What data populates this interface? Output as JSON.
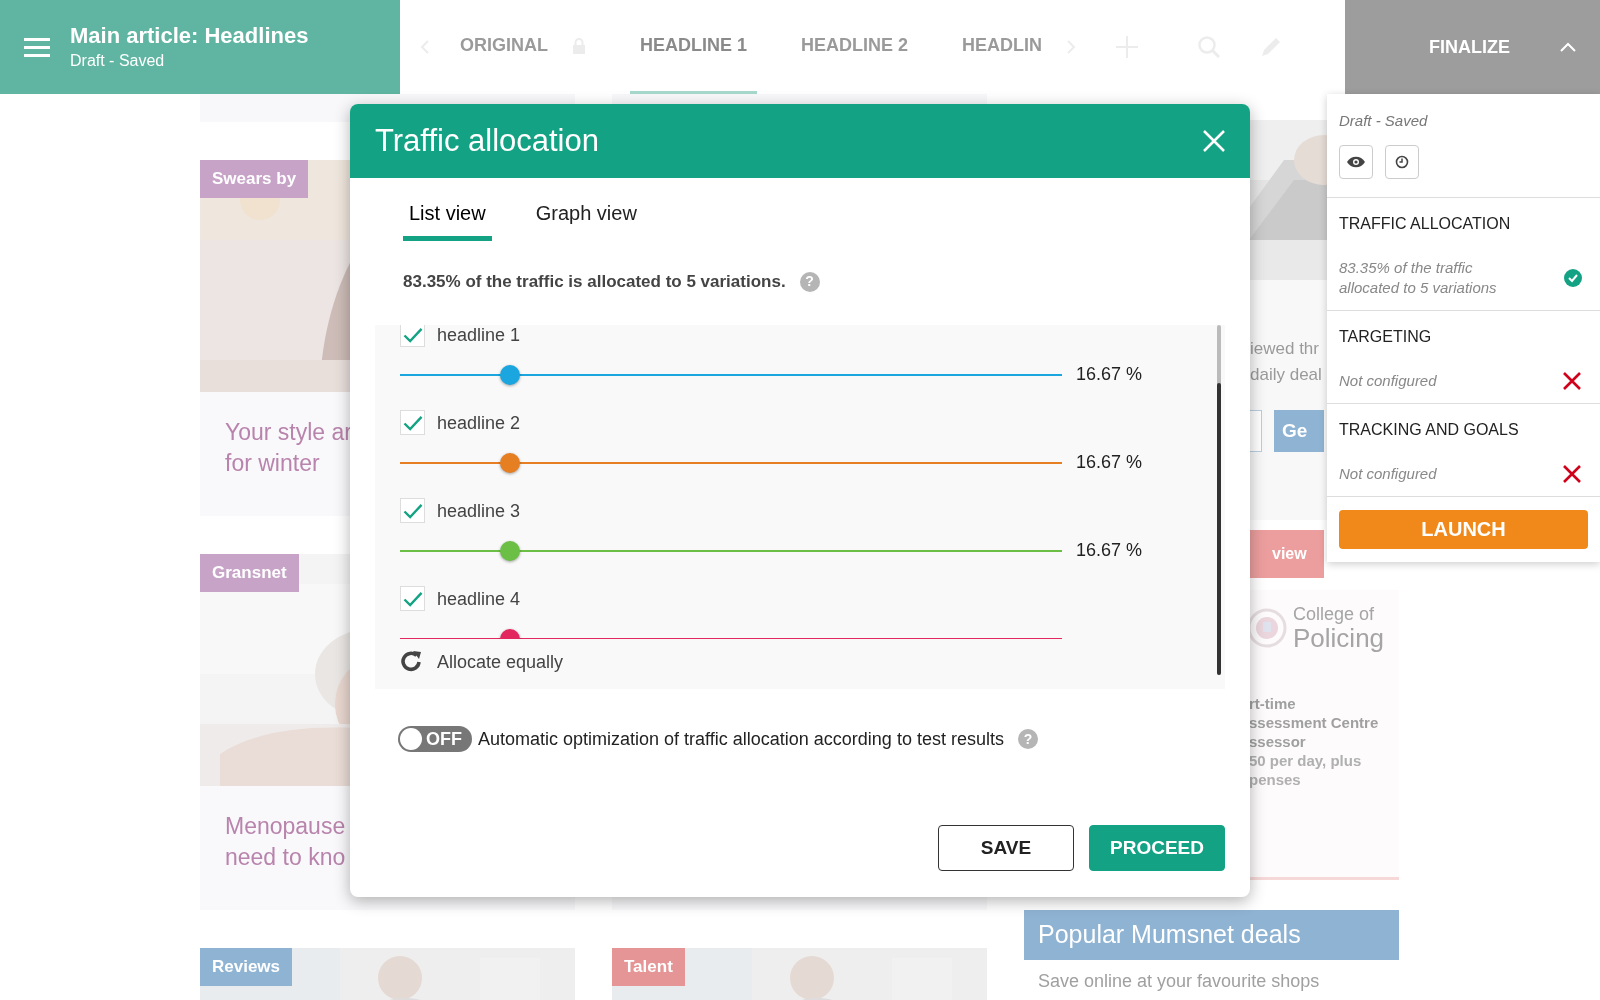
{
  "top_bar": {
    "title": "Main article: Headlines",
    "subtitle": "Draft - Saved",
    "tabs": [
      {
        "label": "ORIGINAL",
        "locked": true,
        "selected": false
      },
      {
        "label": "HEADLINE 1",
        "locked": false,
        "selected": true
      },
      {
        "label": "HEADLINE 2",
        "locked": false,
        "selected": false
      },
      {
        "label": "HEADLIN",
        "locked": false,
        "selected": false
      }
    ],
    "finalize": "FINALIZE"
  },
  "background": {
    "left_column": [
      {
        "tag": "Swears by",
        "color": "#c7a3c7",
        "lines": [
          "Your style ar",
          "for winter"
        ]
      },
      {
        "tag": "Gransnet",
        "color": "#c7a3c8",
        "lines": [
          "Menopause",
          "need to kno"
        ]
      },
      {
        "tag": "Reviews",
        "color": "#8fb3d3"
      }
    ],
    "middle_column": [
      {
        "tag": "Talent",
        "color": "#e59595"
      }
    ],
    "right_column": {
      "promo_lines": [
        "iewed thr",
        "daily deal"
      ],
      "button": "Ge",
      "banner": "view",
      "logo_lines": [
        "College of",
        "Policing"
      ],
      "job_lines": [
        "rt-time",
        "ssessment Centre",
        "ssessor"
      ],
      "pay_lines": [
        "50 per day, plus",
        "penses"
      ],
      "deals_title": "Popular Mumsnet deals",
      "deals_subtitle": "Save online at your favourite shops"
    }
  },
  "modal": {
    "title": "Traffic allocation",
    "tabs": [
      {
        "label": "List view",
        "selected": true
      },
      {
        "label": "Graph view",
        "selected": false
      }
    ],
    "summary": "83.35% of the traffic is allocated to 5 variations.",
    "summary_help": "?",
    "variations": [
      {
        "label": "headline 1",
        "checked": true,
        "color": "#1ba6e0",
        "level": 0.1667,
        "reading": "16.67 %"
      },
      {
        "label": "headline 2",
        "checked": true,
        "color": "#e67e22",
        "level": 0.1667,
        "reading": "16.67 %"
      },
      {
        "label": "headline 3",
        "checked": true,
        "color": "#6cbf45",
        "level": 0.1667,
        "reading": "16.67 %"
      },
      {
        "label": "headline 4",
        "checked": true,
        "color": "#e3285f",
        "level": 0.1667
      }
    ],
    "allocate_equally": "Allocate equally",
    "auto_optimization": {
      "on": false,
      "help": "?",
      "toggle_label": "OFF",
      "label": "Automatic optimization of traffic allocation according to test results"
    },
    "buttons": [
      {
        "label": "SAVE",
        "kind": "secondary"
      },
      {
        "label": "PROCEED",
        "kind": "primary"
      }
    ]
  },
  "finalize_panel": {
    "status": "Draft - Saved",
    "sections": [
      {
        "title": "TRAFFIC ALLOCATION",
        "detail": "83.35% of the traffic allocated to 5 variations",
        "configured": true
      },
      {
        "title": "TARGETING",
        "detail": "Not configured",
        "configured": false
      },
      {
        "title": "TRACKING AND GOALS",
        "detail": "Not configured",
        "configured": false
      }
    ],
    "launch": "LAUNCH"
  }
}
